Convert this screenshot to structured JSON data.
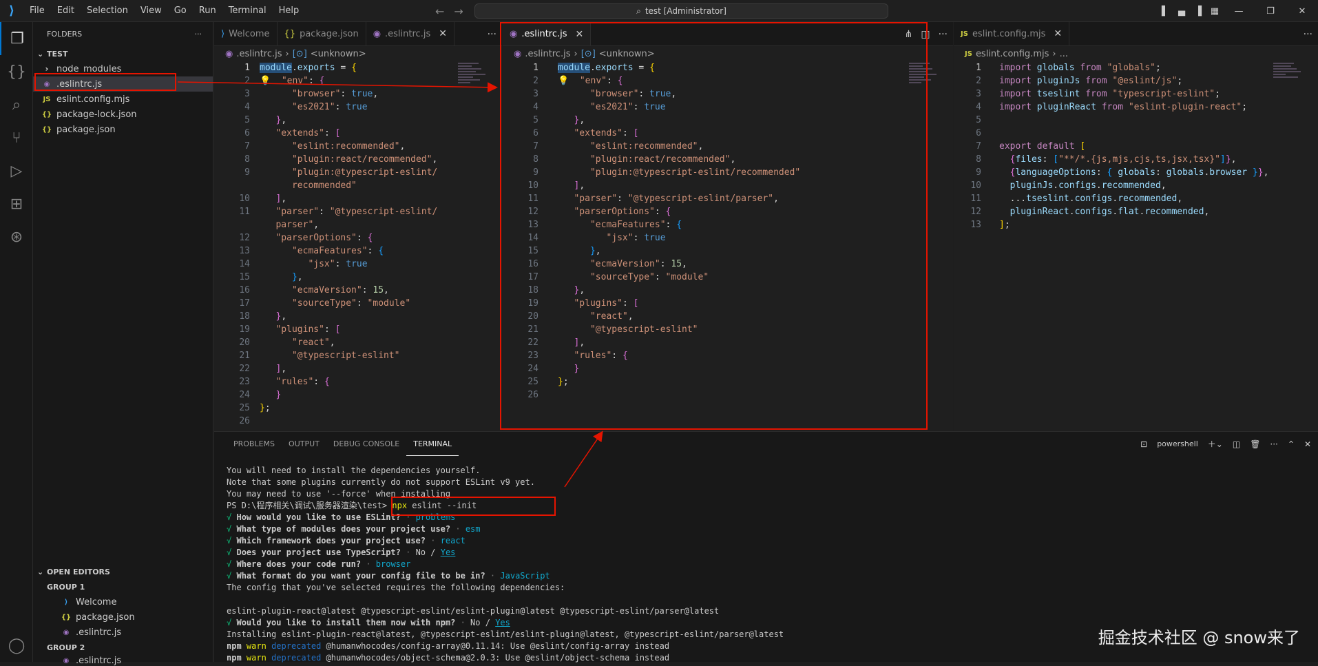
{
  "titlebar": {
    "menus": [
      "File",
      "Edit",
      "Selection",
      "View",
      "Go",
      "Run",
      "Terminal",
      "Help"
    ],
    "search": "test [Administrator]"
  },
  "sidebar": {
    "header": "FOLDERS",
    "root": "TEST",
    "items": [
      {
        "name": "node_modules",
        "icon": "chevron-right-icon"
      },
      {
        "name": ".eslintrc.js",
        "icon": "eslint-icon",
        "selected": true
      },
      {
        "name": "eslint.config.mjs",
        "icon": "js-icon"
      },
      {
        "name": "package-lock.json",
        "icon": "json-icon"
      },
      {
        "name": "package.json",
        "icon": "json-icon"
      }
    ],
    "open_editors": {
      "header": "OPEN EDITORS",
      "group1": "GROUP 1",
      "group1_items": [
        "Welcome",
        "package.json",
        ".eslintrc.js"
      ],
      "group2": "GROUP 2",
      "group2_items": [
        ".eslintrc.js"
      ]
    }
  },
  "editor1": {
    "tabs": [
      "Welcome",
      "package.json",
      ".eslintrc.js"
    ],
    "breadcrumb": [
      ".eslintrc.js",
      "<unknown>"
    ]
  },
  "editor2": {
    "tabs": [
      ".eslintrc.js"
    ],
    "breadcrumb": [
      ".eslintrc.js",
      "<unknown>"
    ]
  },
  "editor3": {
    "tabs": [
      "eslint.config.mjs"
    ],
    "breadcrumb": [
      "eslint.config.mjs",
      "..."
    ]
  },
  "panel": {
    "tabs": [
      "PROBLEMS",
      "OUTPUT",
      "DEBUG CONSOLE",
      "TERMINAL"
    ],
    "active": "TERMINAL",
    "shell": "powershell"
  },
  "terminal": {
    "l1": "You will need to install the dependencies yourself.",
    "l2": "Note that some plugins currently do not support ESLint v9 yet.",
    "l3": "You may need to use '--force' when installing",
    "prompt": "PS D:\\程序相关\\调试\\服务器渲染\\test> ",
    "cmd_npx": "npx",
    "cmd_rest": " eslint --init",
    "q1": "How would you like to use ESLint?",
    "a1": "problems",
    "q2": "What type of modules does your project use?",
    "a2": "esm",
    "q3": "Which framework does your project use?",
    "a3": "react",
    "q4": "Does your project use TypeScript?",
    "a4_no": "No",
    "a4_yes": "Yes",
    "q5": "Where does your code run?",
    "a5": "browser",
    "q6": "What format do you want your config file to be in?",
    "a6": "JavaScript",
    "l_req": "The config that you've selected requires the following dependencies:",
    "l_deps": "eslint-plugin-react@latest @typescript-eslint/eslint-plugin@latest @typescript-eslint/parser@latest",
    "q7": "Would you like to install them now with npm?",
    "a7_no": "No",
    "a7_yes": "Yes",
    "l_inst": "Installing eslint-plugin-react@latest, @typescript-eslint/eslint-plugin@latest, @typescript-eslint/parser@latest",
    "w1": "@humanwhocodes/config-array@0.11.14: Use @eslint/config-array instead",
    "w2": "@humanwhocodes/object-schema@2.0.3: Use @eslint/object-schema instead",
    "npm": "npm",
    "warn": "warn",
    "deprecated": "deprecated",
    "check": "√",
    "sep": " · ",
    "slash": " / "
  },
  "watermark": "掘金技术社区 @ snow来了"
}
